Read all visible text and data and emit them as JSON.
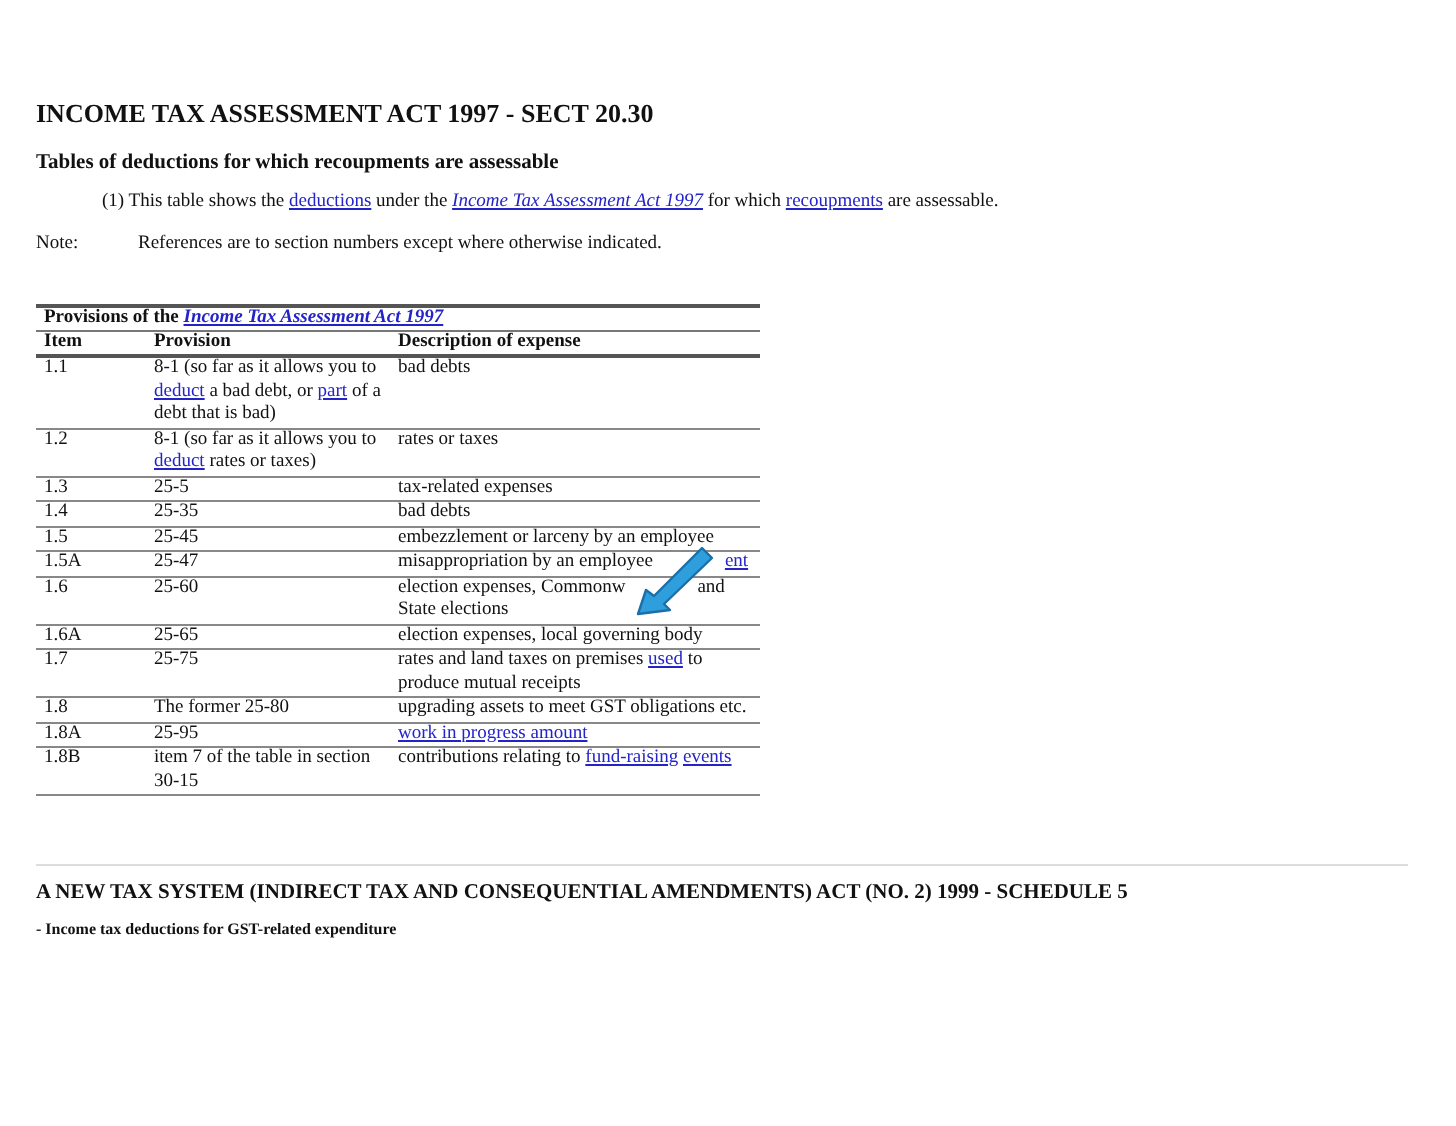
{
  "heading": "INCOME TAX ASSESSMENT ACT 1997 - SECT 20.30",
  "subheading": "Tables of deductions for which recoupments are assessable",
  "paragraph": [
    {
      "kind": "text",
      "text": "(1)  This table shows the "
    },
    {
      "kind": "link",
      "text": "deductions"
    },
    {
      "kind": "text",
      "text": " under the "
    },
    {
      "kind": "link",
      "text": "Income Tax Assessment Act 1997",
      "italic": true
    },
    {
      "kind": "text",
      "text": " for which "
    },
    {
      "kind": "link",
      "text": "recoupments"
    },
    {
      "kind": "text",
      "text": " are assessable."
    }
  ],
  "note": {
    "label": "Note:",
    "text": "References are to section numbers except where otherwise indicated."
  },
  "table": {
    "caption": [
      {
        "kind": "text",
        "text": "Provisions of the "
      },
      {
        "kind": "link",
        "text": "Income Tax Assessment Act 1997",
        "italic": true
      }
    ],
    "columns": [
      "Item",
      "Provision",
      "Description of expense"
    ],
    "rows": [
      {
        "item": "1.1",
        "provision": [
          {
            "kind": "text",
            "text": "8-1 (so far as it allows you to "
          },
          {
            "kind": "link",
            "text": "deduct"
          },
          {
            "kind": "text",
            "text": " a bad debt, or "
          },
          {
            "kind": "link",
            "text": "part"
          },
          {
            "kind": "text",
            "text": " of a debt that is bad)"
          }
        ],
        "description": [
          {
            "kind": "text",
            "text": "bad debts"
          }
        ]
      },
      {
        "item": "1.2",
        "provision": [
          {
            "kind": "text",
            "text": "8-1 (so far as it allows you to "
          },
          {
            "kind": "link",
            "text": "deduct"
          },
          {
            "kind": "text",
            "text": " rates or taxes)"
          }
        ],
        "description": [
          {
            "kind": "text",
            "text": "rates or taxes"
          }
        ]
      },
      {
        "item": "1.3",
        "provision": [
          {
            "kind": "text",
            "text": "25-5"
          }
        ],
        "description": [
          {
            "kind": "text",
            "text": "tax-related expenses"
          }
        ]
      },
      {
        "item": "1.4",
        "provision": [
          {
            "kind": "text",
            "text": "25-35"
          }
        ],
        "description": [
          {
            "kind": "text",
            "text": "bad debts"
          }
        ]
      },
      {
        "item": "1.5",
        "provision": [
          {
            "kind": "text",
            "text": "25-45"
          }
        ],
        "description": [
          {
            "kind": "text",
            "text": "embezzlement or larceny by an employee"
          }
        ]
      },
      {
        "item": "1.5A",
        "provision": [
          {
            "kind": "text",
            "text": "25-47"
          }
        ],
        "description": [
          {
            "kind": "text",
            "text": "misappropriation by an employee"
          },
          {
            "kind": "gap"
          },
          {
            "kind": "link",
            "text": "ent"
          }
        ]
      },
      {
        "item": "1.6",
        "provision": [
          {
            "kind": "text",
            "text": "25-60"
          }
        ],
        "description": [
          {
            "kind": "text",
            "text": "election expenses, Commonw"
          },
          {
            "kind": "gap"
          },
          {
            "kind": "text",
            "text": "and State elections"
          }
        ]
      },
      {
        "item": "1.6A",
        "provision": [
          {
            "kind": "text",
            "text": "25-65"
          }
        ],
        "description": [
          {
            "kind": "text",
            "text": "election expenses, local governing body"
          }
        ]
      },
      {
        "item": "1.7",
        "provision": [
          {
            "kind": "text",
            "text": "25-75"
          }
        ],
        "description": [
          {
            "kind": "text",
            "text": "rates and land taxes on premises "
          },
          {
            "kind": "link",
            "text": "used"
          },
          {
            "kind": "text",
            "text": " to produce mutual receipts"
          }
        ]
      },
      {
        "item": "1.8",
        "provision": [
          {
            "kind": "text",
            "text": "The former 25-80"
          }
        ],
        "description": [
          {
            "kind": "text",
            "text": "upgrading assets to meet GST obligations etc."
          }
        ]
      },
      {
        "item": "1.8A",
        "provision": [
          {
            "kind": "text",
            "text": "25-95"
          }
        ],
        "description": [
          {
            "kind": "link",
            "text": "work in progress amount"
          }
        ]
      },
      {
        "item": "1.8B",
        "provision": [
          {
            "kind": "text",
            "text": "item 7 of the table in section 30-15"
          }
        ],
        "description": [
          {
            "kind": "text",
            "text": "contributions relating to "
          },
          {
            "kind": "link",
            "text": "fund-raising"
          },
          {
            "kind": "link",
            "text": "events"
          }
        ]
      }
    ]
  },
  "next_heading": "A NEW TAX SYSTEM (INDIRECT TAX AND CONSEQUENTIAL AMENDMENTS) ACT (NO. 2) 1999 - SCHEDULE 5",
  "next_subheading": "- Income tax deductions for GST-related expenditure"
}
